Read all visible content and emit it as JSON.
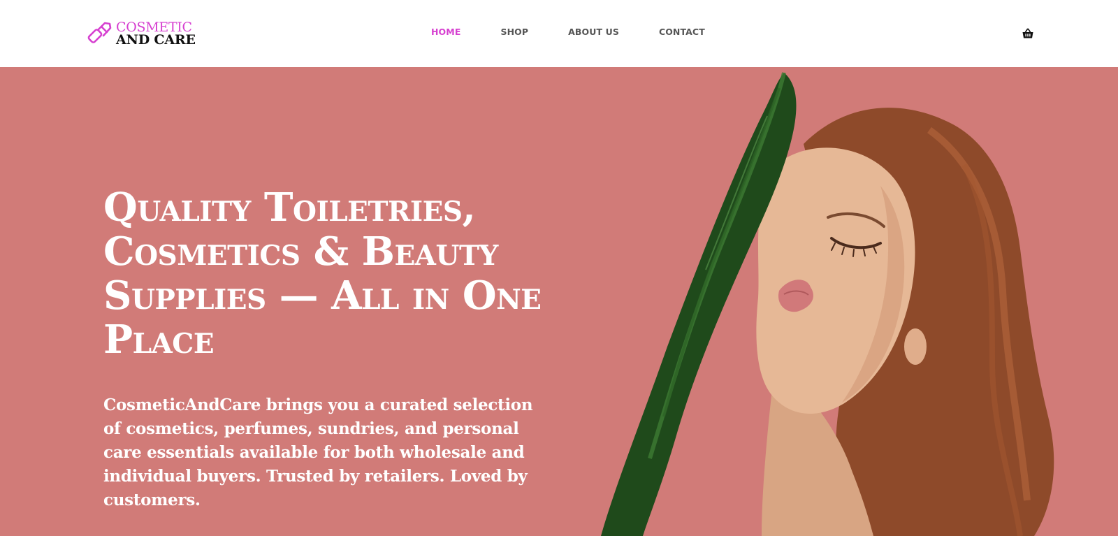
{
  "brand": {
    "line1": "COSMETIC",
    "line2": "AND CARE",
    "accent_color": "#d63fd0"
  },
  "nav": {
    "items": [
      {
        "label": "HOME",
        "active": true
      },
      {
        "label": "SHOP",
        "active": false
      },
      {
        "label": "ABOUT US",
        "active": false
      },
      {
        "label": "CONTACT",
        "active": false
      }
    ]
  },
  "cart": {
    "icon": "basket-icon"
  },
  "hero": {
    "background_color": "#d17b78",
    "title": "Quality Toiletries, Cosmetics & Beauty Supplies — All in One Place",
    "description": "CosmeticAndCare brings you a curated selection of cosmetics, perfumes, sundries, and personal care essentials available for both wholesale and individual buyers. Trusted by retailers. Loved by customers.",
    "image": "woman-with-leaf-photo"
  }
}
